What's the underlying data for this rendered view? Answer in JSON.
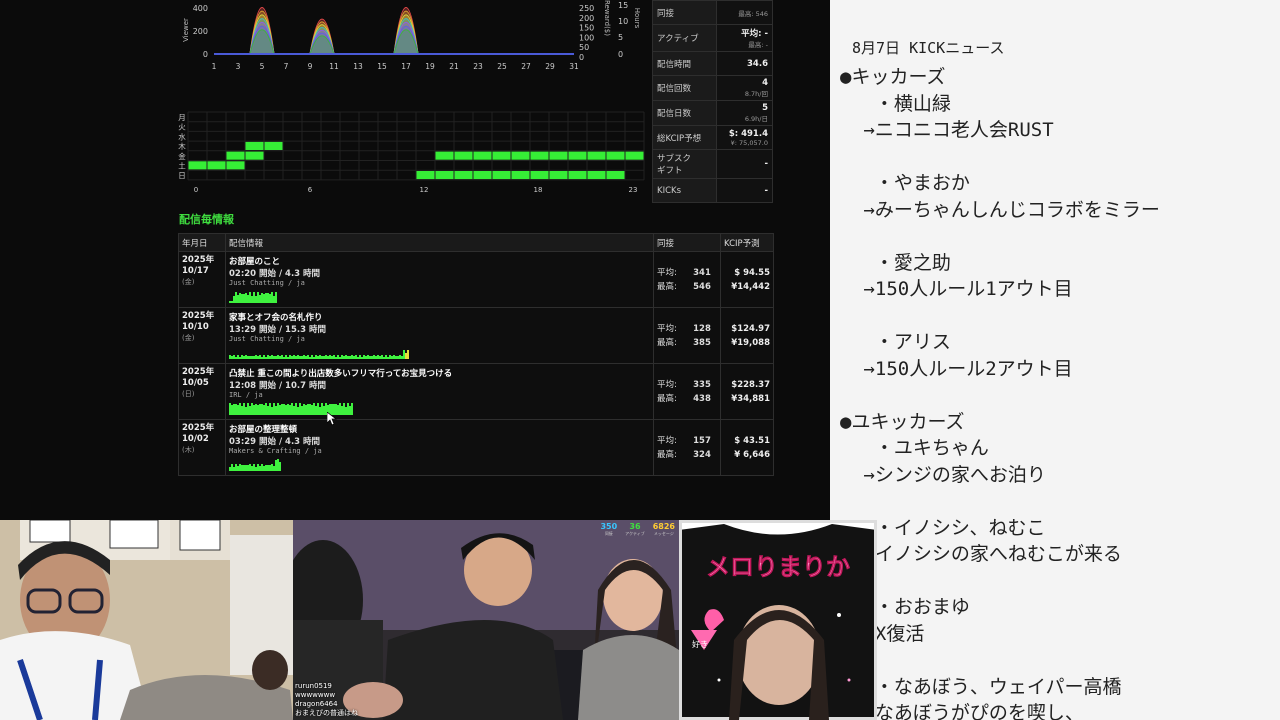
{
  "stats": {
    "rows": [
      {
        "key": "同接",
        "value": "",
        "sub": "最高: 546"
      },
      {
        "key": "アクティブ",
        "value": "平均: -",
        "sub": "最高: -"
      },
      {
        "key": "配信時間",
        "value": "34.6",
        "sub": ""
      },
      {
        "key": "配信回数",
        "value": "4",
        "sub": "8.7h/回"
      },
      {
        "key": "配信日数",
        "value": "5",
        "sub": "6.9h/日"
      },
      {
        "key": "総KCIP予想",
        "value": "$: 491.4",
        "sub": "¥: 75,057.0"
      },
      {
        "key": "サブスク\nギフト",
        "value": "-",
        "sub": ""
      },
      {
        "key": "KICKs",
        "value": "-",
        "sub": ""
      }
    ]
  },
  "top_chart": {
    "y_ticks_left": [
      "400",
      "200",
      "0"
    ],
    "y_ticks_right1": [
      "250",
      "200",
      "150",
      "100",
      "50",
      "0"
    ],
    "y_ticks_right2": [
      "15",
      "10",
      "5",
      "0"
    ],
    "ylabel_left": "Viewer",
    "ylabel_right1": "Reward($)",
    "ylabel_right2": "Hours",
    "x_ticks": [
      "1",
      "3",
      "5",
      "7",
      "9",
      "11",
      "13",
      "15",
      "17",
      "19",
      "21",
      "23",
      "25",
      "27",
      "29",
      "31"
    ]
  },
  "heatmap": {
    "days": [
      "月",
      "火",
      "水",
      "木",
      "金",
      "土",
      "日"
    ],
    "x_ticks": [
      "0",
      "6",
      "12",
      "18",
      "23"
    ]
  },
  "section_title": "配信毎情報",
  "table": {
    "headers": [
      "年月日",
      "配信情報",
      "同接",
      "KCIP予測"
    ],
    "rows": [
      {
        "year": "2025年",
        "md": "10/17",
        "dow": "(金)",
        "title": "お部屋のこと",
        "time": "02:20 開始 / 4.3 時間",
        "category": "Just Chatting / ja",
        "avg": "341",
        "max": "546",
        "usd": "$ 94.55",
        "jpy": "¥14,442"
      },
      {
        "year": "2025年",
        "md": "10/10",
        "dow": "(金)",
        "title": "家事とオフ会の名札作り",
        "time": "13:29 開始 / 15.3 時間",
        "category": "Just Chatting / ja",
        "avg": "128",
        "max": "385",
        "usd": "$124.97",
        "jpy": "¥19,088"
      },
      {
        "year": "2025年",
        "md": "10/05",
        "dow": "(日)",
        "title": "凸禁止 重この間より出店数多いフリマ行ってお宝見つける",
        "time": "12:08 開始 / 10.7 時間",
        "category": "IRL / ja",
        "avg": "335",
        "max": "438",
        "usd": "$228.37",
        "jpy": "¥34,881"
      },
      {
        "year": "2025年",
        "md": "10/02",
        "dow": "(木)",
        "title": "お部屋の整理整頓",
        "time": "03:29 開始 / 4.3 時間",
        "category": "Makers & Crafting / ja",
        "avg": "157",
        "max": "324",
        "usd": "$ 43.51",
        "jpy": "¥ 6,646"
      }
    ],
    "avg_label": "平均:",
    "max_label": "最高:"
  },
  "notes": {
    "header": "8月7日 KICKニュース",
    "lines": [
      "●キッカーズ",
      "  ・横山緑",
      " →ニコニコ老人会RUST",
      "",
      "  ・やまおか",
      " →みーちゃんしんじコラボをミラー",
      "",
      "  ・愛之助",
      " →150人ルール1アウト目",
      "",
      "  ・アリス",
      " →150人ルール2アウト目",
      "",
      "●ユキッカーズ",
      "  ・ユキちゃん",
      " →シンジの家へお泊り",
      "",
      "  ・イノシシ、ねむこ",
      " →イノシシの家へねむこが来る",
      "",
      "  ・おおまゆ",
      " →X復活",
      "",
      "  ・なあぼう、ウェイパー高橋",
      " →なあぼうがぴのを喫し、"
    ]
  },
  "cams": {
    "overlay": [
      {
        "value": "350",
        "label": "同接",
        "color": "#39c6ff"
      },
      {
        "value": "36",
        "label": "アクティブ",
        "color": "#3fe03f"
      },
      {
        "value": "6826",
        "label": "メッセージ",
        "color": "#ffcc33"
      }
    ],
    "chat": [
      "rurun0519",
      "wwwwwww",
      "dragon6464",
      "おまえぴの普通はね"
    ],
    "shirt_text": "メロりまりか",
    "heart_text": "好き"
  },
  "colors": {
    "accent_green": "#3ff23f",
    "dash_bg": "#0b0b0b",
    "notes_bg": "#f4f4f4"
  }
}
